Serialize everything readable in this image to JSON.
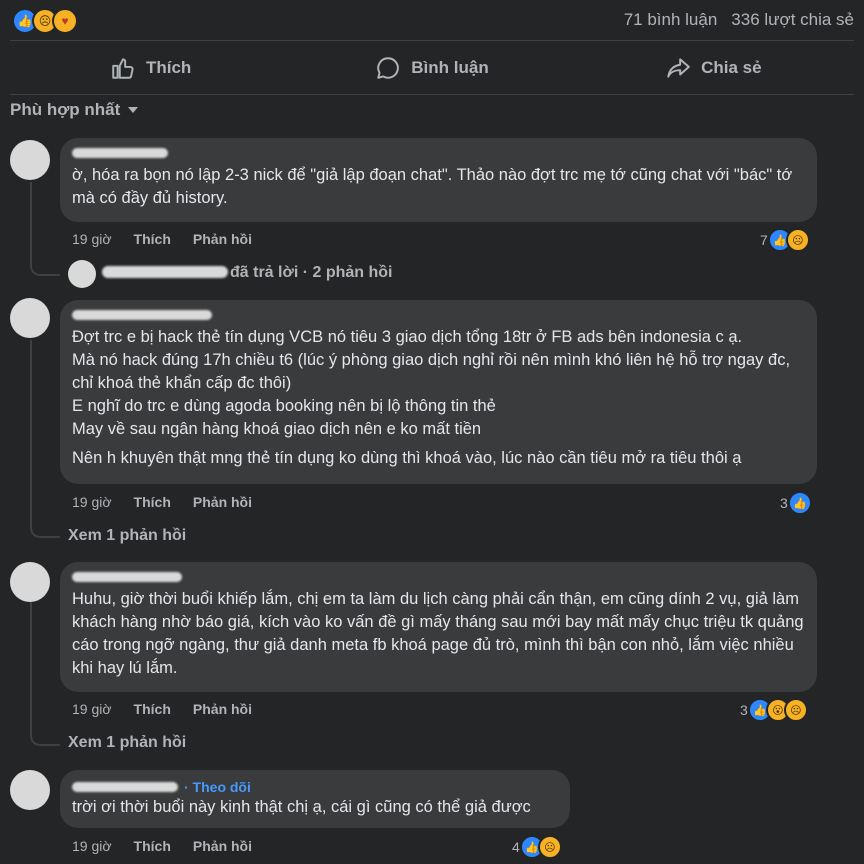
{
  "stats": {
    "reaction_icons": [
      "like-icon",
      "sad-icon",
      "care-icon"
    ],
    "comments_count": "71 bình luận",
    "shares_count": "336 lượt chia sẻ"
  },
  "actions": {
    "like": "Thích",
    "comment": "Bình luận",
    "share": "Chia sẻ"
  },
  "sort": {
    "label": "Phù hợp nhất"
  },
  "comments": [
    {
      "text": "ờ, hóa ra bọn nó lập 2-3 nick để \"giả lập đoạn chat\". Thảo nào đợt trc mẹ tớ cũng chat với \"bác\" tớ mà có đầy đủ history.",
      "time": "19 giờ",
      "like": "Thích",
      "reply": "Phản hồi",
      "reaction_count": "7",
      "reaction_icons": [
        "like-icon",
        "sad-icon"
      ],
      "replies_summary": "đã trả lời · 2 phản hồi"
    },
    {
      "text": "Đợt trc e bị hack thẻ tín dụng VCB nó tiêu 3 giao dịch tổng 18tr ở FB ads bên indonesia c ạ.\nMà nó hack đúng 17h chiều t6 (lúc ý phòng giao dịch nghỉ rồi nên mình khó liên hệ hỗ trợ ngay đc, chỉ khoá thẻ khẩn cấp đc thôi)\nE nghĩ do trc e dùng agoda booking nên bị lộ thông tin thẻ\nMay về sau ngân hàng khoá giao dịch nên e ko mất tiền",
      "text2": "Nên h khuyên thật mng thẻ tín dụng ko dùng thì khoá vào, lúc nào cần tiêu mở ra tiêu thôi ạ",
      "time": "19 giờ",
      "like": "Thích",
      "reply": "Phản hồi",
      "reaction_count": "3",
      "reaction_icons": [
        "like-icon"
      ],
      "replies_summary": "Xem 1 phản hồi"
    },
    {
      "text": "Huhu, giờ thời buổi khiếp lắm, chị em ta làm du lịch càng phải cẩn thận, em cũng dính 2 vụ, giả làm khách hàng nhờ báo giá, kích vào ko vấn đề gì mấy tháng sau mới bay mất mấy chục triệu tk quảng cáo trong ngỡ ngàng, thư giả danh meta fb khoá page đủ trò, mình thì bận con nhỏ, lắm việc nhiều khi hay lú lắm.",
      "time": "19 giờ",
      "like": "Thích",
      "reply": "Phản hồi",
      "reaction_count": "3",
      "reaction_icons": [
        "like-icon",
        "wow-icon",
        "sad-icon"
      ],
      "replies_summary": "Xem 1 phản hồi"
    },
    {
      "follow": "· Theo dõi",
      "text": "trời ơi thời buổi này kinh thật chị ạ, cái gì cũng có thể giả được",
      "time": "19 giờ",
      "like": "Thích",
      "reply": "Phản hồi",
      "reaction_count": "4",
      "reaction_icons": [
        "like-icon",
        "sad-icon"
      ]
    }
  ]
}
